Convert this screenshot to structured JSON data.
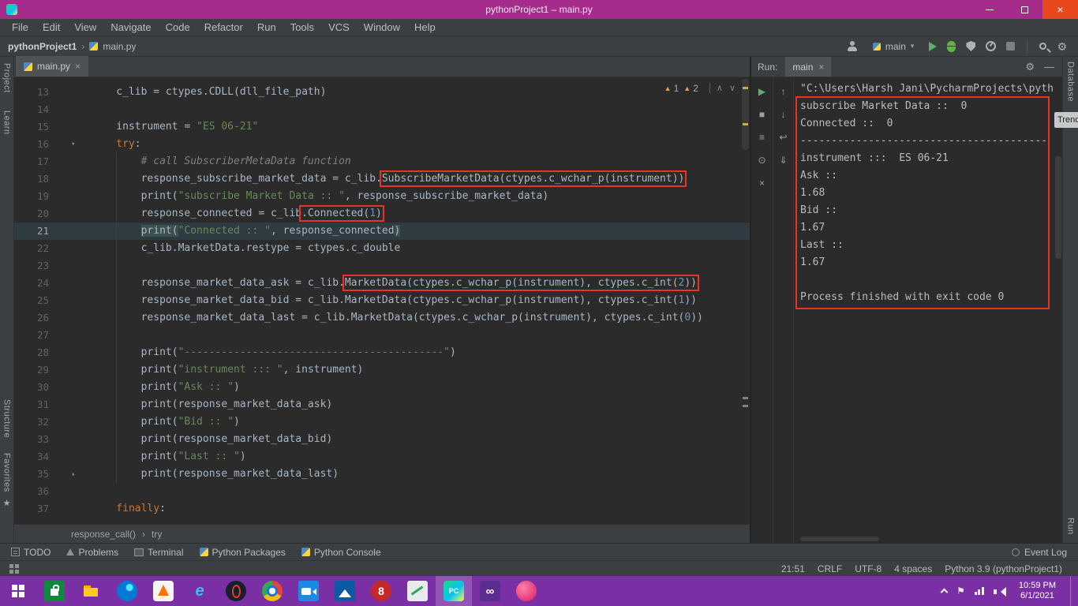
{
  "colors": {
    "titlebar": "#a62c8c",
    "taskbar": "#7a2fa5",
    "close": "#e8481c",
    "panel": "#3c3f41",
    "editorbg": "#2b2b2b",
    "tabactive": "#4e5254",
    "red": "#ea3323",
    "keyword": "#cc7832",
    "string": "#6a8759",
    "number": "#6897bb",
    "comment": "#808080",
    "text": "#a9b7c6",
    "linenum": "#606366",
    "console": "#bcbcbc",
    "warning": "#d9a740",
    "green": "#5fad65"
  },
  "icons": {
    "warning": "▲",
    "close": "×",
    "gear": "⚙",
    "star": "★",
    "flag": "⚑",
    "chevron-up": "∧",
    "chevron-down": "∨",
    "breadcrumb-sep": "›",
    "dropdown-caret": "▾",
    "fold-open": "▾",
    "fold-end": "▴",
    "minimize": "—"
  },
  "title_bar": {
    "title": "pythonProject1 – main.py"
  },
  "menu": {
    "items": [
      "File",
      "Edit",
      "View",
      "Navigate",
      "Code",
      "Refactor",
      "Run",
      "Tools",
      "VCS",
      "Window",
      "Help"
    ]
  },
  "toolbar": {
    "breadcrumbs": [
      "pythonProject1",
      "main.py"
    ],
    "run_config": "main"
  },
  "tool_stripes": {
    "left": [
      "Project",
      "Learn",
      "Structure",
      "Favorites"
    ],
    "right_top": [
      "Database"
    ],
    "right_bottom": [
      "Run"
    ]
  },
  "right_popup": {
    "label": "Trend"
  },
  "editor": {
    "tab": "main.py",
    "warnings": [
      "1",
      "2"
    ],
    "breadcrumbs": [
      "response_call()",
      "try"
    ],
    "lines": [
      {
        "n": 13,
        "i": 4,
        "segs": [
          [
            "d",
            "c_lib = ctypes.CDLL(dll_file_path)"
          ]
        ]
      },
      {
        "n": 14,
        "i": 0,
        "segs": []
      },
      {
        "n": 15,
        "i": 4,
        "segs": [
          [
            "d",
            "instrument = "
          ],
          [
            "s",
            "\"ES 06-21\""
          ]
        ]
      },
      {
        "n": 16,
        "i": 4,
        "fold": "open",
        "segs": [
          [
            "k",
            "try"
          ],
          [
            "d",
            ":"
          ]
        ]
      },
      {
        "n": 17,
        "i": 8,
        "segs": [
          [
            "c",
            "# call SubscriberMetaData function"
          ]
        ]
      },
      {
        "n": 18,
        "i": 8,
        "segs": [
          [
            "d",
            "response_subscribe_market_data = c_lib."
          ],
          [
            "d",
            "SubscribeMarketData(ctypes.c_wchar_p(instrument))",
            1
          ]
        ]
      },
      {
        "n": 19,
        "i": 8,
        "segs": [
          [
            "d",
            "print("
          ],
          [
            "s",
            "\"subscribe Market Data :: \""
          ],
          [
            "d",
            ", response_subscribe_market_data)"
          ]
        ]
      },
      {
        "n": 20,
        "i": 8,
        "segs": [
          [
            "d",
            "response_connected = c_lib"
          ],
          [
            "d",
            ".Connected(",
            1
          ],
          [
            "n",
            "1",
            1
          ],
          [
            "d",
            ")",
            1
          ]
        ]
      },
      {
        "n": 21,
        "i": 8,
        "cur": true,
        "segs": [
          [
            "p",
            "print("
          ],
          [
            "s",
            "\"Connected :: \""
          ],
          [
            "d",
            ", response_connected"
          ],
          [
            "p",
            ")"
          ]
        ]
      },
      {
        "n": 22,
        "i": 8,
        "segs": [
          [
            "d",
            "c_lib.MarketData.restype = ctypes.c_double"
          ]
        ]
      },
      {
        "n": 23,
        "i": 0,
        "segs": []
      },
      {
        "n": 24,
        "i": 8,
        "segs": [
          [
            "d",
            "response_market_data_ask = c_lib."
          ],
          [
            "d",
            "MarketData(ctypes.c_wchar_p(instrument), ctypes.c_int(",
            1
          ],
          [
            "n",
            "2",
            1
          ],
          [
            "d",
            "))",
            1
          ]
        ]
      },
      {
        "n": 25,
        "i": 8,
        "segs": [
          [
            "d",
            "response_market_data_bid = c_lib.MarketData(ctypes.c_wchar_p(instrument), ctypes.c_int("
          ],
          [
            "n",
            "1"
          ],
          [
            "d",
            "))"
          ]
        ]
      },
      {
        "n": 26,
        "i": 8,
        "segs": [
          [
            "d",
            "response_market_data_last = c_lib.MarketData(ctypes.c_wchar_p(instrument), ctypes.c_int("
          ],
          [
            "n",
            "0"
          ],
          [
            "d",
            "))"
          ]
        ]
      },
      {
        "n": 27,
        "i": 0,
        "segs": []
      },
      {
        "n": 28,
        "i": 8,
        "segs": [
          [
            "d",
            "print("
          ],
          [
            "s",
            "\"------------------------------------------\""
          ],
          [
            "d",
            ")"
          ]
        ]
      },
      {
        "n": 29,
        "i": 8,
        "segs": [
          [
            "d",
            "print("
          ],
          [
            "s",
            "\"instrument ::: \""
          ],
          [
            "d",
            ", instrument)"
          ]
        ]
      },
      {
        "n": 30,
        "i": 8,
        "segs": [
          [
            "d",
            "print("
          ],
          [
            "s",
            "\"Ask :: \""
          ],
          [
            "d",
            ")"
          ]
        ]
      },
      {
        "n": 31,
        "i": 8,
        "segs": [
          [
            "d",
            "print(response_market_data_ask)"
          ]
        ]
      },
      {
        "n": 32,
        "i": 8,
        "segs": [
          [
            "d",
            "print("
          ],
          [
            "s",
            "\"Bid :: \""
          ],
          [
            "d",
            ")"
          ]
        ]
      },
      {
        "n": 33,
        "i": 8,
        "segs": [
          [
            "d",
            "print(response_market_data_bid)"
          ]
        ]
      },
      {
        "n": 34,
        "i": 8,
        "segs": [
          [
            "d",
            "print("
          ],
          [
            "s",
            "\"Last :: \""
          ],
          [
            "d",
            ")"
          ]
        ]
      },
      {
        "n": 35,
        "i": 8,
        "fold": "end",
        "segs": [
          [
            "d",
            "print(response_market_data_last)"
          ]
        ]
      },
      {
        "n": 36,
        "i": 0,
        "segs": []
      },
      {
        "n": 37,
        "i": 4,
        "segs": [
          [
            "k",
            "finally"
          ],
          [
            "d",
            ":"
          ]
        ]
      }
    ]
  },
  "run_panel": {
    "label": "Run:",
    "tab": "main",
    "toolbar_main": [
      {
        "name": "rerun-button",
        "g": "▶",
        "cls": "green"
      },
      {
        "name": "stop-button",
        "g": "■"
      },
      {
        "name": "restore-layout-button",
        "g": "≡"
      },
      {
        "name": "pin-tab-button",
        "g": "⊙"
      },
      {
        "name": "close-content-button",
        "g": "×"
      }
    ],
    "toolbar_console": [
      {
        "name": "up-stack-trace-button",
        "g": "↑"
      },
      {
        "name": "down-stack-trace-button",
        "g": "↓"
      },
      {
        "name": "soft-wrap-button",
        "g": "↩"
      },
      {
        "name": "scroll-to-end-button",
        "g": "⇓"
      }
    ],
    "output": [
      "\"C:\\Users\\Harsh Jani\\PycharmProjects\\pyth",
      "subscribe Market Data ::  0",
      "Connected ::  0",
      "----------------------------------------",
      "instrument :::  ES 06-21",
      "Ask :: ",
      "1.68",
      "Bid :: ",
      "1.67",
      "Last :: ",
      "1.67",
      "",
      "Process finished with exit code 0"
    ]
  },
  "status_bar": {
    "tools": [
      {
        "icon": "todo",
        "label": "TODO"
      },
      {
        "icon": "problems",
        "label": "Problems"
      },
      {
        "icon": "terminal",
        "label": "Terminal"
      },
      {
        "icon": "python",
        "label": "Python Packages"
      },
      {
        "icon": "python",
        "label": "Python Console"
      }
    ],
    "event_log": "Event Log",
    "info": [
      "21:51",
      "CRLF",
      "UTF-8",
      "4 spaces",
      "Python 3.9 (pythonProject1)"
    ]
  },
  "taskbar": {
    "time": "10:59 PM",
    "date": "6/1/2021",
    "apps": [
      {
        "name": "store"
      },
      {
        "name": "file-explorer"
      },
      {
        "name": "edge"
      },
      {
        "name": "vlc"
      },
      {
        "name": "internet-explorer",
        "g": "e"
      },
      {
        "name": "opera"
      },
      {
        "name": "chrome"
      },
      {
        "name": "camera-app"
      },
      {
        "name": "photos"
      },
      {
        "name": "eight-ball",
        "g": "8"
      },
      {
        "name": "notes"
      },
      {
        "name": "pycharm",
        "g": "PC",
        "active": true
      },
      {
        "name": "visual-studio",
        "g": "∞"
      },
      {
        "name": "paint"
      }
    ]
  }
}
